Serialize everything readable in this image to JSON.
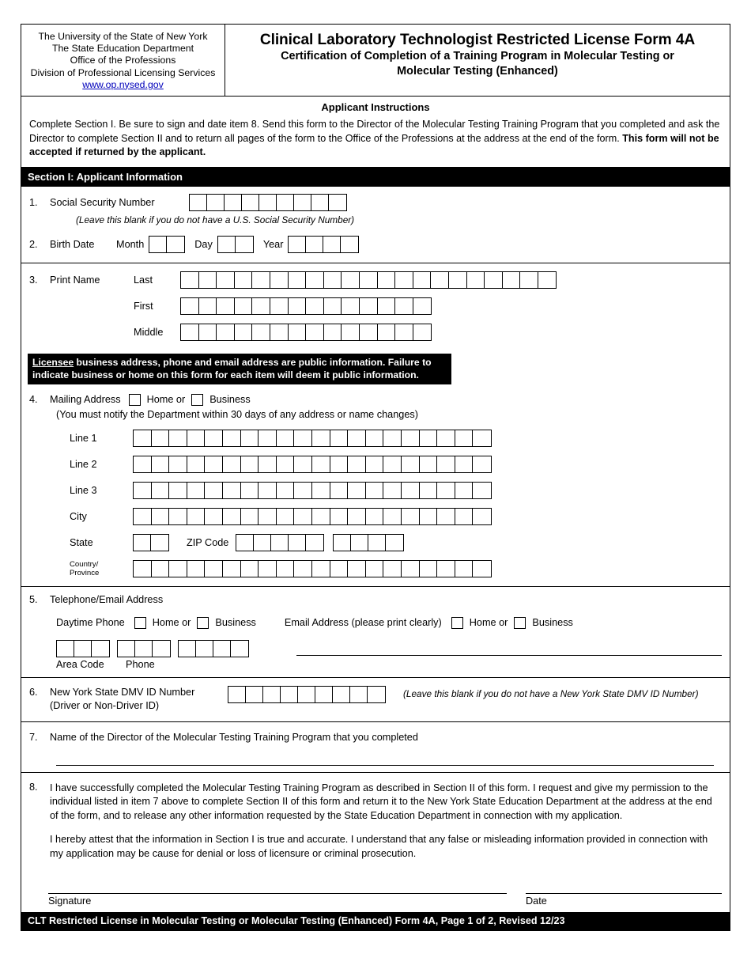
{
  "header": {
    "agency_lines": [
      "The University of the State of New York",
      "The State Education Department",
      "Office of the Professions",
      "Division of Professional Licensing Services"
    ],
    "website": "www.op.nysed.gov",
    "title": "Clinical Laboratory Technologist Restricted License Form 4A",
    "subtitle_line1": "Certification of Completion of a Training Program in Molecular Testing or",
    "subtitle_line2": "Molecular Testing (Enhanced)"
  },
  "instructions": {
    "title": "Applicant Instructions",
    "body_part1": "Complete Section I. Be sure to sign and date item 8. Send this form to the Director of the Molecular Testing Training Program that you completed and ask the Director to complete Section II and to return all pages of the form to the Office of the Professions at the address at the end of the form. ",
    "body_bold": "This form will not be accepted",
    "body_part2": " if returned by the applicant."
  },
  "section1": {
    "bar_label": "Section I: Applicant Information",
    "item1": {
      "number": "1.",
      "label": "Social Security Number",
      "boxes": 9,
      "note": "(Leave this blank if you do not have a U.S. Social Security Number)"
    },
    "item2": {
      "number": "2.",
      "label": "Birth Date",
      "month_label": "Month",
      "month_boxes": 2,
      "day_label": "Day",
      "day_boxes": 2,
      "year_label": "Year",
      "year_boxes": 4
    },
    "item3": {
      "number": "3.",
      "label": "Print Name",
      "rows": [
        {
          "label": "Last",
          "boxes": 21
        },
        {
          "label": "First",
          "boxes": 14
        },
        {
          "label": "Middle",
          "boxes": 14
        }
      ]
    },
    "licensee_notice": {
      "underlined_word": "Licensee",
      "text": " business address, phone and email address are public information. Failure to indicate business or home on this form for each item will deem it public information."
    },
    "item4": {
      "number": "4.",
      "label": "Mailing Address",
      "home_label": "Home or",
      "business_label": "Business",
      "note": "(You must notify the Department within 30 days of any address or name changes)",
      "rows": [
        {
          "label": "Line 1",
          "boxes": 20
        },
        {
          "label": "Line 2",
          "boxes": 20
        },
        {
          "label": "Line 3",
          "boxes": 20
        },
        {
          "label": "City",
          "boxes": 20
        }
      ],
      "state_label": "State",
      "state_boxes": 2,
      "zip_label": "ZIP Code",
      "zip_boxes": 5,
      "zip_plus4_boxes": 4,
      "country_label_line1": "Country/",
      "country_label_line2": "Province",
      "country_boxes": 20
    },
    "item5": {
      "number": "5.",
      "label": "Telephone/Email Address",
      "phone_label": "Daytime Phone",
      "phone_home_label": "Home or",
      "phone_business_label": "Business",
      "email_label": "Email Address (please print clearly)",
      "email_home_label": "Home or",
      "email_business_label": "Business",
      "area_boxes": 3,
      "prefix_boxes": 3,
      "line_boxes": 4,
      "area_caption": "Area Code",
      "phone_caption": "Phone"
    },
    "item6": {
      "number": "6.",
      "label_line1": "New York State DMV ID Number",
      "label_line2": "(Driver or Non-Driver ID)",
      "boxes": 9,
      "note": "(Leave this blank if you do not have a New York State DMV ID Number)"
    },
    "item7": {
      "number": "7.",
      "label": "Name of the Director of the Molecular Testing Training Program that you completed"
    },
    "item8": {
      "number": "8.",
      "paragraph1": "I have successfully completed the Molecular Testing Training Program as described in Section II of this form. I request and give my permission to the individual listed in item 7 above to complete Section II of this form and return it to the New York State Education Department at the address at the end of the form, and to release any other information requested by the State Education Department in connection with my application.",
      "paragraph2": "I hereby attest that the information in Section I is true and accurate. I understand that any false or misleading information provided in connection with my application may be cause for denial or loss of licensure or criminal prosecution.",
      "signature_label": "Signature",
      "date_label": "Date"
    }
  },
  "footer": {
    "text": "CLT Restricted License in Molecular Testing or Molecular Testing (Enhanced) Form 4A, Page 1 of 2, Revised 12/23"
  },
  "colors": {
    "bar_background": "#000000",
    "bar_text": "#ffffff",
    "link": "#0000bb"
  }
}
